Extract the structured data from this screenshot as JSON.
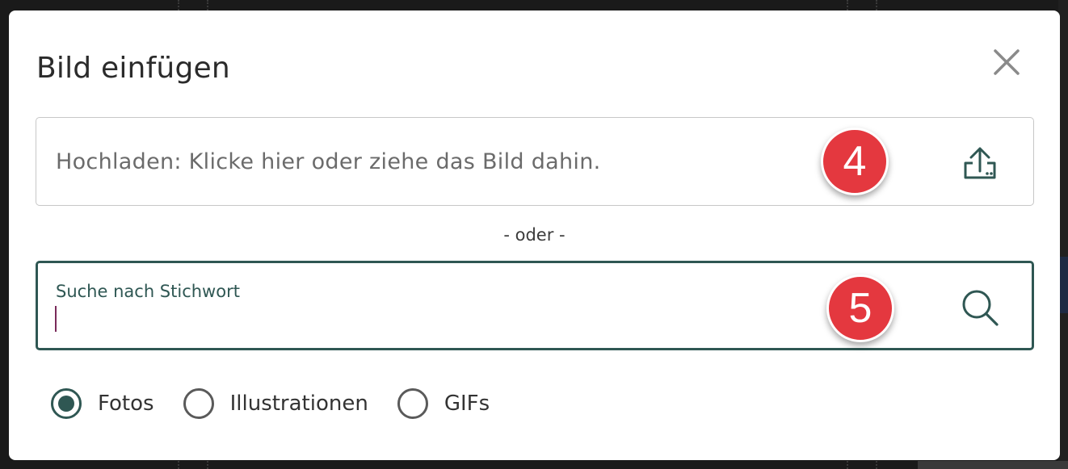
{
  "dialog": {
    "title": "Bild einfügen",
    "close_icon": "close-icon"
  },
  "upload": {
    "text": "Hochladen: Klicke hier oder ziehe das Bild dahin.",
    "icon": "upload-icon",
    "marker": "4"
  },
  "separator": "- oder -",
  "search": {
    "label": "Suche nach Stichwort",
    "value": "",
    "icon": "search-icon",
    "marker": "5"
  },
  "image_types": {
    "selected": "Fotos",
    "options": [
      {
        "label": "Fotos",
        "checked": true
      },
      {
        "label": "Illustrationen",
        "checked": false
      },
      {
        "label": "GIFs",
        "checked": false
      }
    ]
  },
  "colors": {
    "accent": "#2f5753",
    "marker": "#e4383f",
    "text": "#2b2b2b",
    "muted_text": "#6b6b6b",
    "border": "#c7c7c7"
  }
}
